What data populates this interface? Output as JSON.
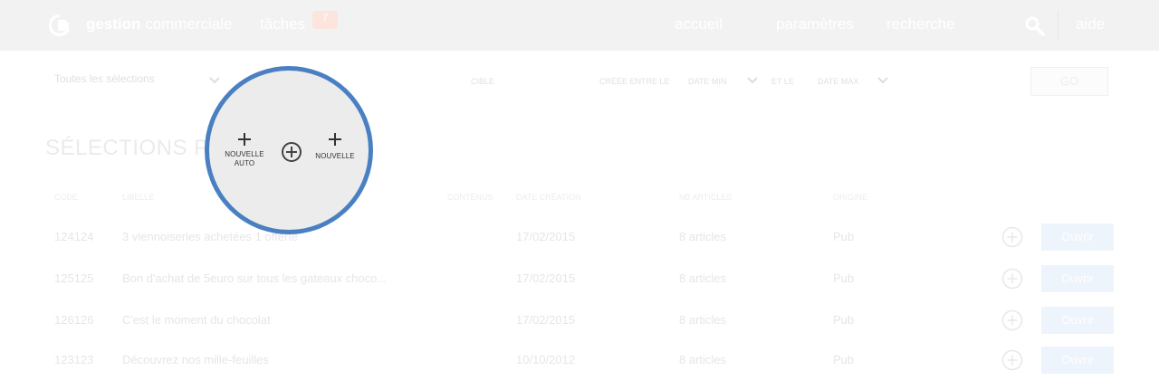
{
  "header": {
    "app_name_bold": "gestion",
    "app_name_light": "commerciale",
    "nav": {
      "tasks": "tâches",
      "home": "accueil",
      "settings": "paramètres",
      "search": "recherche",
      "help": "aide"
    },
    "tasks_badge": "7"
  },
  "filters": {
    "selection": "Toutes les sélections",
    "cible": "CIBLE",
    "created_between": "CRÉÉE ENTRE LE",
    "date_from": "DATE MIN",
    "and": "ET LE",
    "date_to": "DATE MAX",
    "go": "GO"
  },
  "page_title": "SÉLECTIONS PRO",
  "table": {
    "headers": [
      "CODE",
      "LIBELLÉ",
      "CONTENUS",
      "DATE CRÉATION",
      "NB ARTICLES",
      "ORIGINE"
    ],
    "rows": [
      {
        "code": "124124",
        "label": "3 viennoiseries achetées 1 offerte",
        "date": "17/02/2015",
        "count": "8 articles",
        "origin": "Pub",
        "action": "Ouvrir"
      },
      {
        "code": "125125",
        "label": "Bon d'achat de 5euro sur tous les gateaux choco...",
        "date": "17/02/2015",
        "count": "8 articles",
        "origin": "Pub",
        "action": "Ouvrir"
      },
      {
        "code": "126126",
        "label": "C'est le moment du chocolat",
        "date": "17/02/2015",
        "count": "8 articles",
        "origin": "Pub",
        "action": "Ouvrir"
      },
      {
        "code": "123123",
        "label": "Découvrez nos mille-feuilles",
        "date": "10/10/2012",
        "count": "8 articles",
        "origin": "Pub",
        "action": "Ouvrir"
      }
    ]
  },
  "lens": {
    "new_auto": "NOUVELLE AUTO",
    "new": "NOUVELLE",
    "border_color": "#4a80c2"
  },
  "colors": {
    "accent": "#4a80c2",
    "topbar": "#f2f2f2"
  }
}
